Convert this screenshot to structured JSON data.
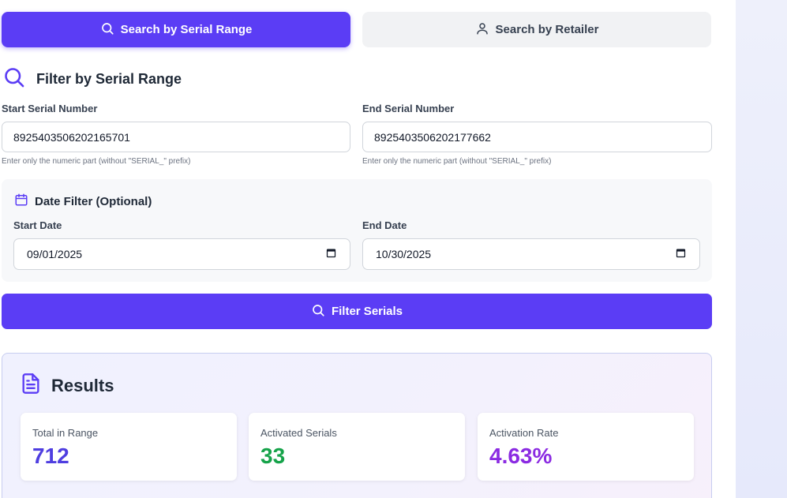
{
  "tabs": {
    "serial_label": "Search by Serial Range",
    "retailer_label": "Search by Retailer"
  },
  "section": {
    "title": "Filter by Serial Range"
  },
  "start_serial": {
    "label": "Start Serial Number",
    "value": "8925403506202165701",
    "hint": "Enter only the numeric part (without \"SERIAL_\" prefix)"
  },
  "end_serial": {
    "label": "End Serial Number",
    "value": "8925403506202177662",
    "hint": "Enter only the numeric part (without \"SERIAL_\" prefix)"
  },
  "date_filter": {
    "title": "Date Filter (Optional)",
    "start_label": "Start Date",
    "start_value": "09/01/2025",
    "end_label": "End Date",
    "end_value": "10/30/2025"
  },
  "filter_button": {
    "label": "Filter Serials"
  },
  "results": {
    "title": "Results",
    "stats": [
      {
        "label": "Total in Range",
        "value": "712",
        "color": "#4f3ee0"
      },
      {
        "label": "Activated Serials",
        "value": "33",
        "color": "#16a34a"
      },
      {
        "label": "Activation Rate",
        "value": "4.63%",
        "color": "#8b2be2"
      }
    ]
  },
  "colors": {
    "accent": "#5b3df5",
    "icon_accent": "#5b3df5"
  },
  "icons": [
    "search-icon",
    "user-icon",
    "calendar-icon",
    "document-icon"
  ]
}
